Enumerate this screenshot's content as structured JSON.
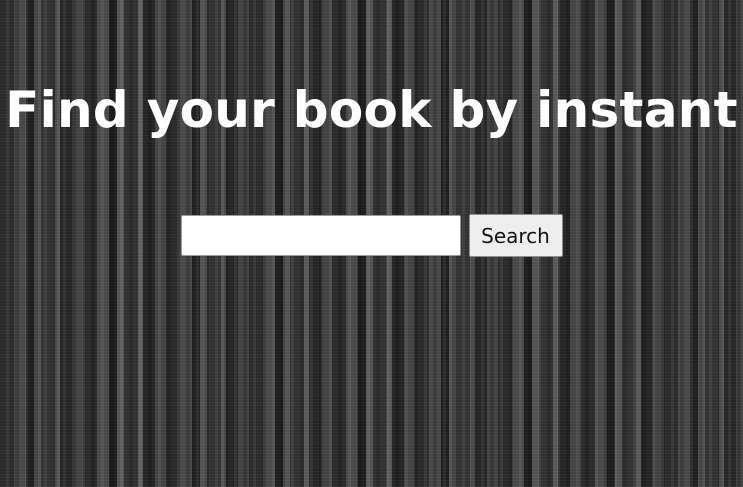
{
  "page": {
    "title": "Find your book by instant",
    "background_color": "#3a3a3a",
    "title_color": "#ffffff"
  },
  "search": {
    "value": "",
    "placeholder": "",
    "button_label": "Search"
  }
}
